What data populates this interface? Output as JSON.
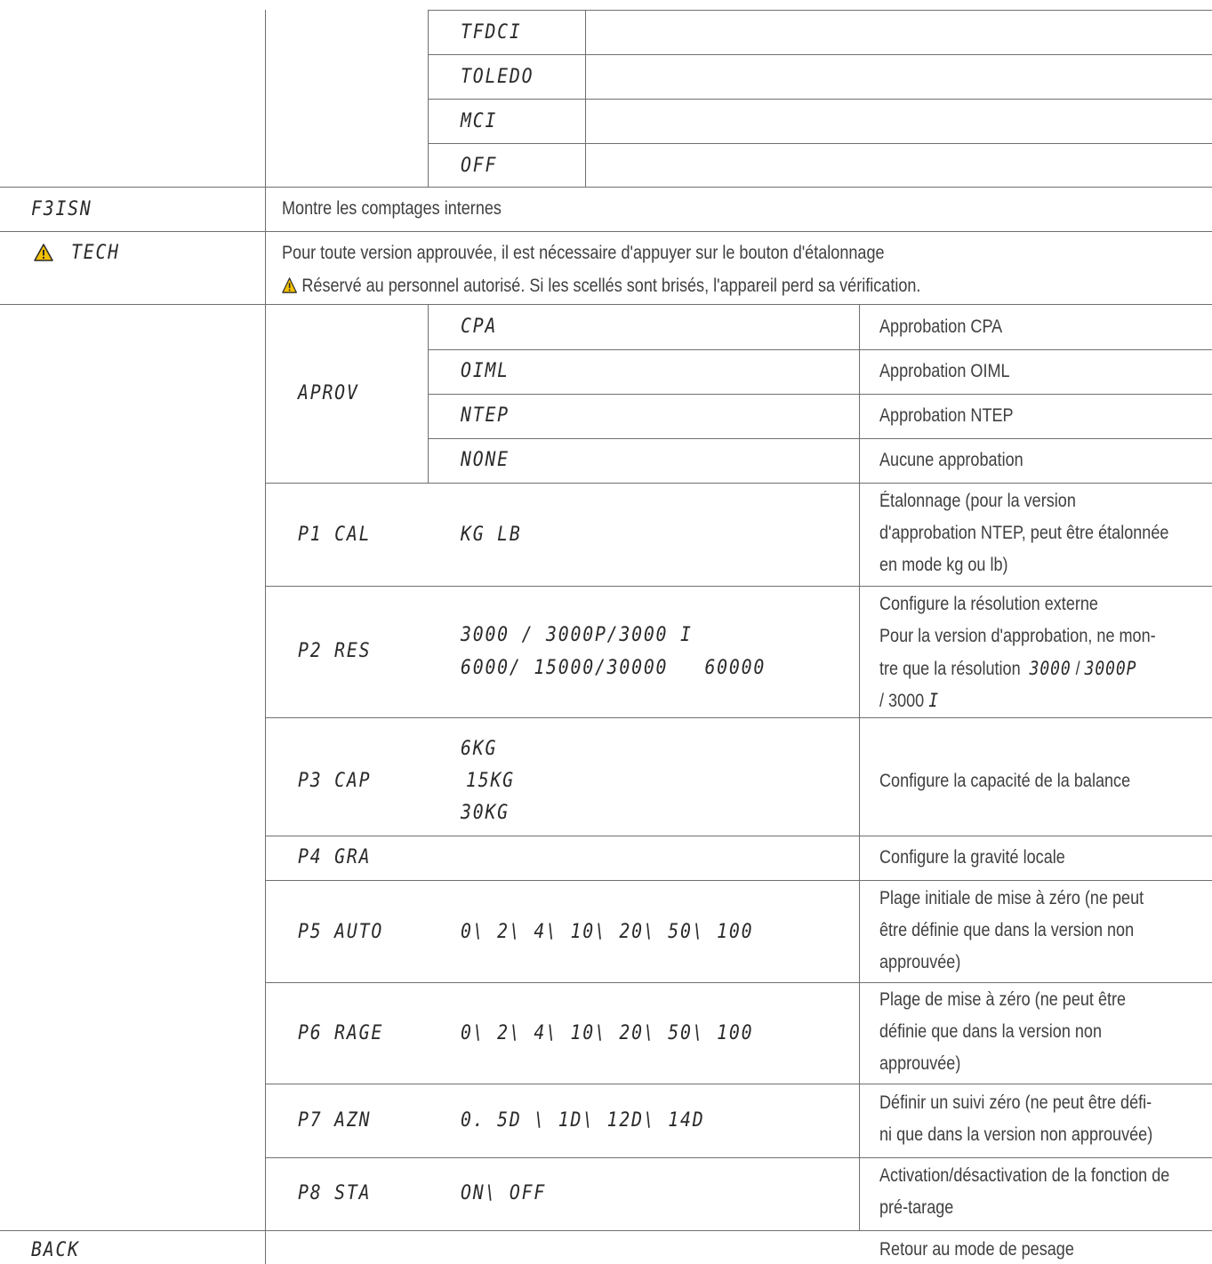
{
  "top_options": [
    "TFDCI",
    "TOLEDO",
    "MCI",
    "OFF"
  ],
  "f3isn": {
    "code": "F3ISN",
    "desc": "Montre les comptages internes"
  },
  "tech": {
    "code": "TECH",
    "line1": "Pour toute version approuvée, il est nécessaire d'appuyer sur le bouton d'étalonnage",
    "line2": "Réservé au personnel autorisé. Si les scellés sont brisés, l'appareil perd sa vérification."
  },
  "aprov": {
    "code": "APROV",
    "rows": [
      {
        "opt": "CPA",
        "desc": "Approbation CPA"
      },
      {
        "opt": "OIML",
        "desc": "Approbation OIML"
      },
      {
        "opt": "NTEP",
        "desc": "Approbation NTEP"
      },
      {
        "opt": "NONE",
        "desc": "Aucune approbation"
      }
    ]
  },
  "p1": {
    "code": "P1 CAL",
    "opt": "KG LB",
    "desc": [
      "Étalonnage (pour la version",
      "d'approbation NTEP, peut être étalonnée",
      "en mode kg ou lb)"
    ]
  },
  "p2": {
    "code": "P2 RES",
    "opt1a": "3000",
    "sep": "/",
    "opt1b": "3000P",
    "opt1c": "3000 I",
    "opt2a": "6000",
    "opt2b": "15000",
    "opt2c": "30000",
    "opt2d": "60000",
    "desc1": "Configure la résolution externe",
    "desc2": "Pour la version d'approbation, ne mon-",
    "desc3a": "tre que la résolution",
    "desc3b": "3000",
    "desc3c": "/",
    "desc3d": "3000P",
    "desc4a": "/ 3000",
    "desc4b": "I"
  },
  "p3": {
    "code": "P3 CAP",
    "opts": [
      "6KG",
      "15KG",
      "30KG"
    ],
    "desc": "Configure la capacité de la balance"
  },
  "p4": {
    "code": "P4 GRA",
    "desc": "Configure la gravité locale"
  },
  "p5": {
    "code": "P5 AUTO",
    "opt": "0\\ 2\\ 4\\ 10\\ 20\\ 50\\ 100",
    "desc": [
      "Plage initiale de mise à zéro (ne peut",
      "être définie que dans la version non",
      "approuvée)"
    ]
  },
  "p6": {
    "code": "P6 RAGE",
    "opt": "0\\ 2\\ 4\\ 10\\ 20\\ 50\\ 100",
    "desc": [
      "Plage de mise à zéro (ne peut être",
      "définie que dans la version non",
      "approuvée)"
    ]
  },
  "p7": {
    "code": "P7 AZN",
    "opt": "0. 5D \\ 1D\\ 12D\\ 14D",
    "desc": [
      "Définir un suivi zéro (ne peut être défi-",
      "ni que dans la version non approuvée)"
    ]
  },
  "p8": {
    "code": "P8 STA",
    "opt": "ON\\ OFF",
    "desc": [
      "Activation/désactivation de la fonction de",
      "pré-tarage"
    ]
  },
  "back": {
    "code": "BACK",
    "desc": "Retour au mode de pesage"
  },
  "colors": {
    "warning_fill": "#f5c000",
    "line": "#6f6f6f"
  }
}
